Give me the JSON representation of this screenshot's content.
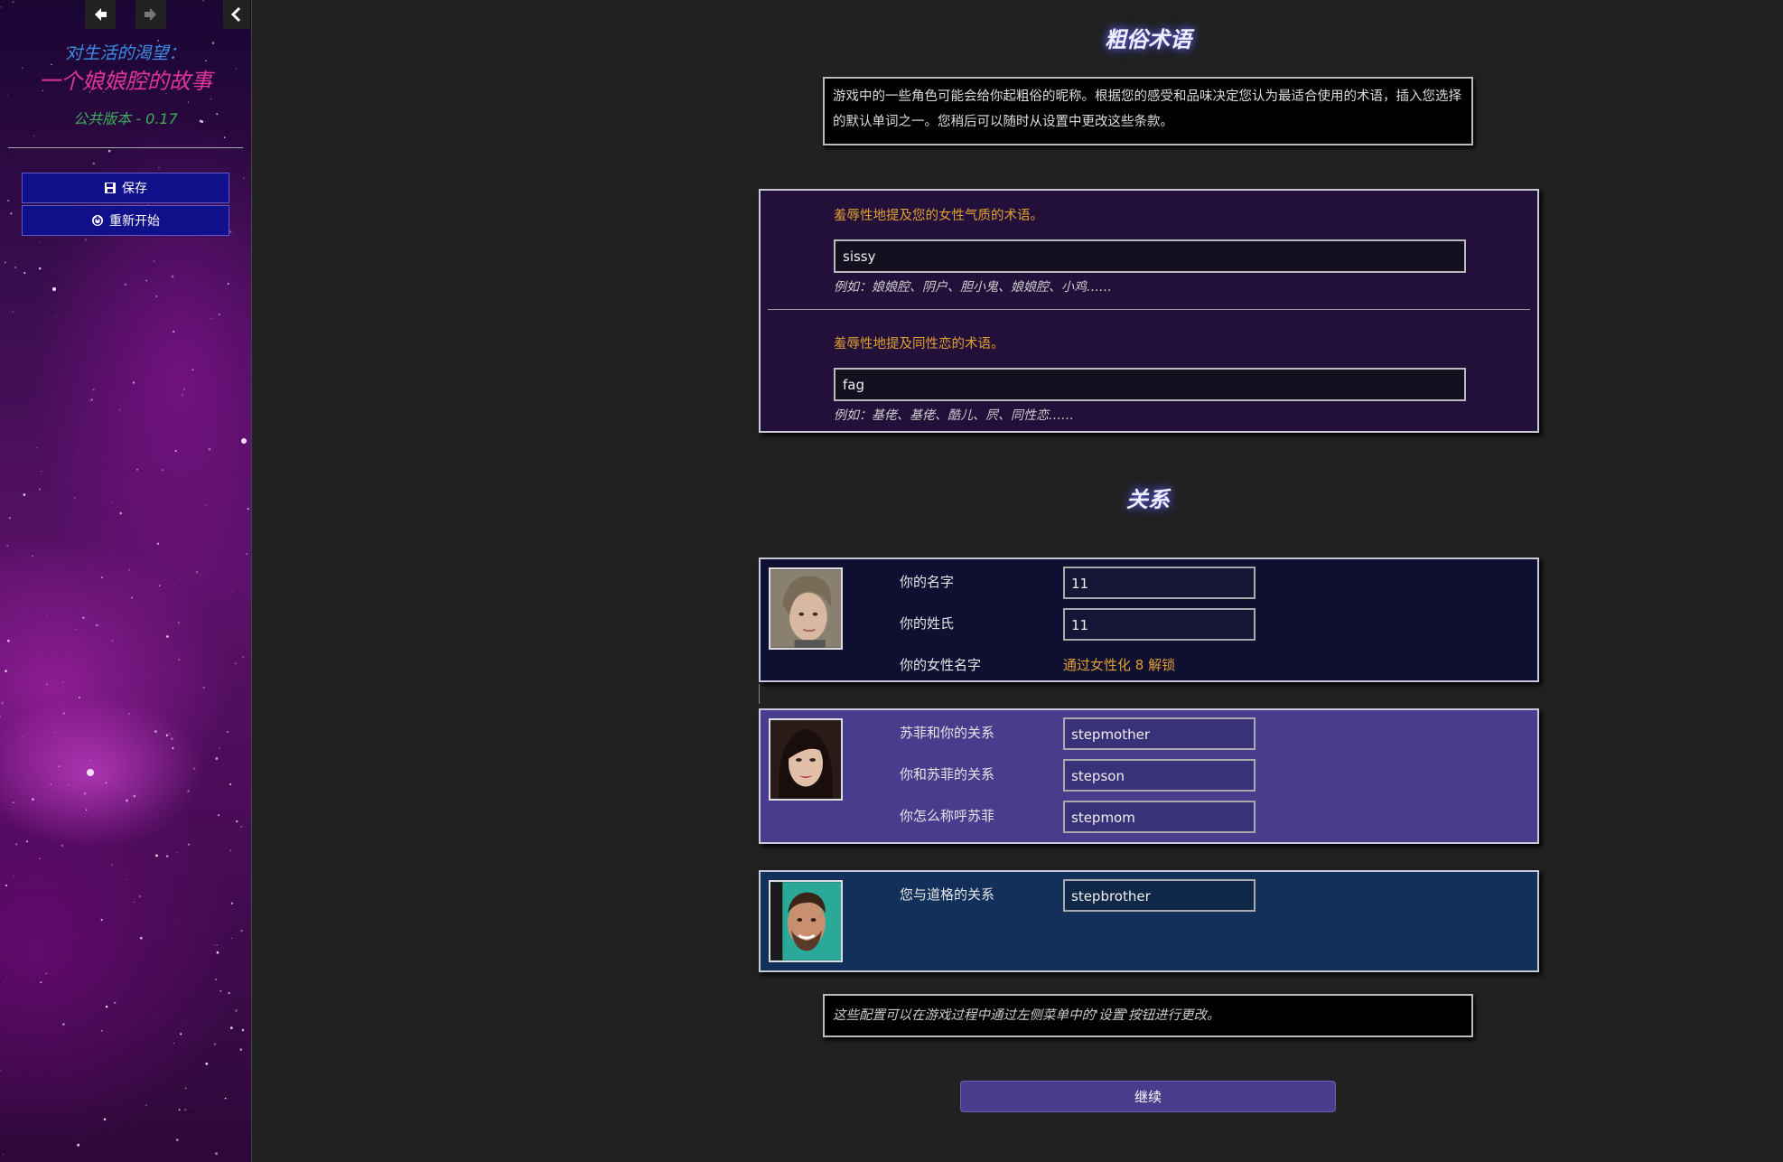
{
  "sidebar": {
    "title_line1": "对生活的渴望：",
    "title_line2": "一个娘娘腔的故事",
    "version": "公共版本 - 0.17",
    "save_label": "保存",
    "restart_label": "重新开始"
  },
  "slurs": {
    "title": "粗俗术语",
    "intro": "游戏中的一些角色可能会给你起粗俗的昵称。根据您的感受和品味决定您认为最适合使用的术语，插入您选择的默认单词之一。您稍后可以随时从设置中更改这些条款。",
    "fem_label": "羞辱性地提及您的女性气质的术语。",
    "fem_value": "sissy",
    "fem_example": "例如：娘娘腔、阴户、胆小鬼、娘娘腔、小鸡……",
    "gay_label": "羞辱性地提及同性恋的术语。",
    "gay_value": "fag",
    "gay_example": "例如：基佬、基佬、酷儿、屄、同性恋……"
  },
  "relations": {
    "title": "关系",
    "player": {
      "first_name_label": "你的名字",
      "first_name_value": "11",
      "last_name_label": "你的姓氏",
      "last_name_value": "11",
      "fem_name_label": "你的女性名字",
      "fem_name_locked": "通过女性化 8 解锁"
    },
    "sophie": {
      "rel1_label": "苏菲和你的关系",
      "rel1_value": "stepmother",
      "rel2_label": "你和苏菲的关系",
      "rel2_value": "stepson",
      "rel3_label": "你怎么称呼苏菲",
      "rel3_value": "stepmom"
    },
    "doug": {
      "rel1_label": "您与道格的关系",
      "rel1_value": "stepbrother"
    },
    "footer_note": "这些配置可以在游戏过程中通过左侧菜单中的'设置'按钮进行更改。"
  },
  "continue_label": "继续",
  "colors": {
    "accent_orange": "#e0a030",
    "panel_purple": "#473d8c",
    "panel_navy": "#0f0f32",
    "panel_blue": "#13305a",
    "side_button": "#10108a"
  }
}
